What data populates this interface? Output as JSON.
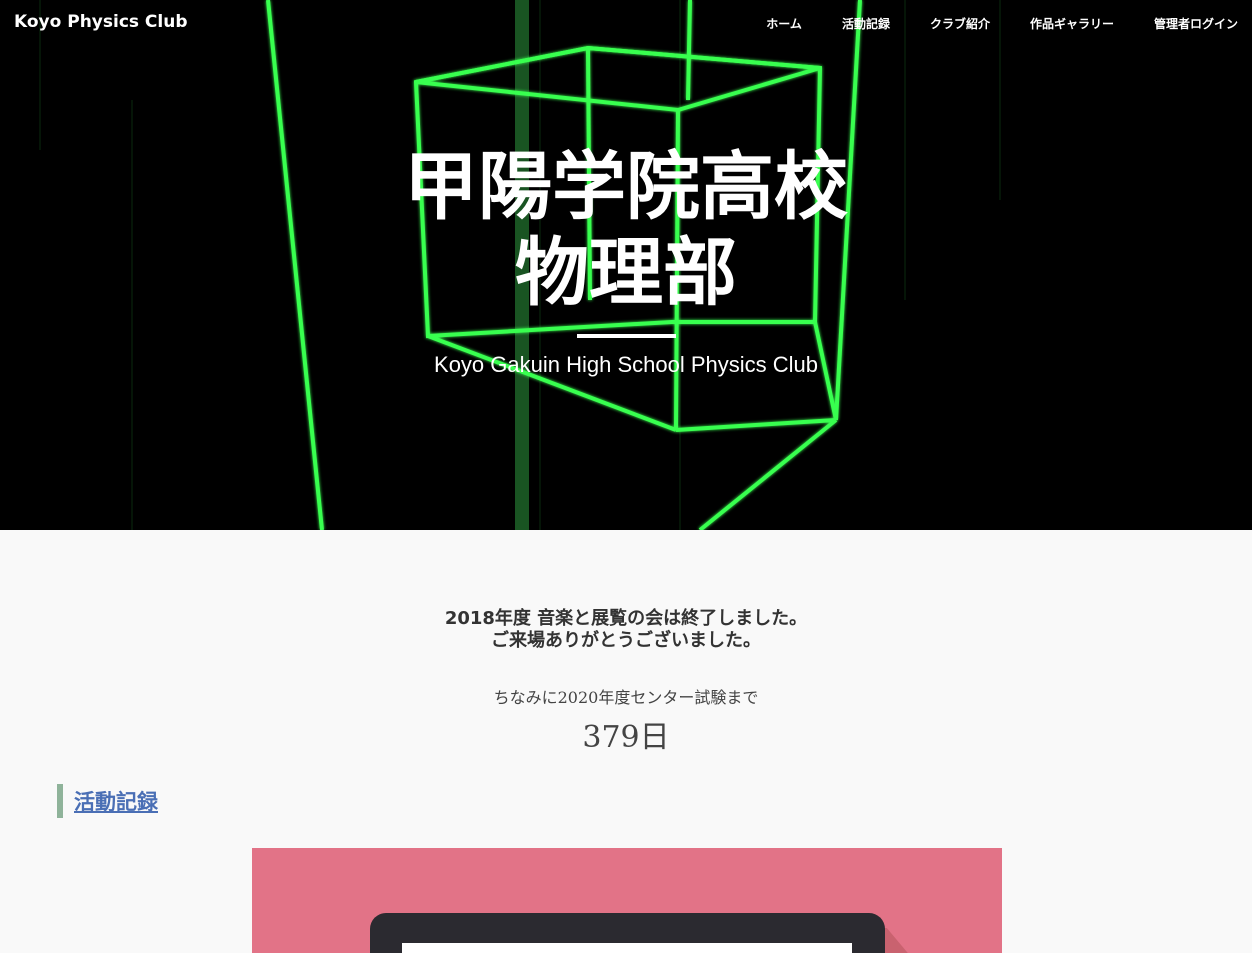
{
  "header": {
    "site_title": "Koyo Physics Club",
    "nav": [
      "ホーム",
      "活動記録",
      "クラブ紹介",
      "作品ギャラリー",
      "管理者ログイン"
    ]
  },
  "hero": {
    "title_line1": "甲陽学院高校",
    "title_line2": "物理部",
    "subtitle": "Koyo Gakuin High School Physics Club",
    "accent_color": "#33ff55"
  },
  "notice": {
    "line1": "2018年度 音楽と展覧の会は終了しました。",
    "line2": "ご来場ありがとうございました。"
  },
  "countdown": {
    "label": "ちなみに2020年度センター試験まで",
    "value": "379日"
  },
  "section": {
    "heading": "活動記録",
    "accent_color": "#8fb39a",
    "link_color": "#4a6fb5"
  },
  "feature": {
    "background_color": "#e27387"
  }
}
